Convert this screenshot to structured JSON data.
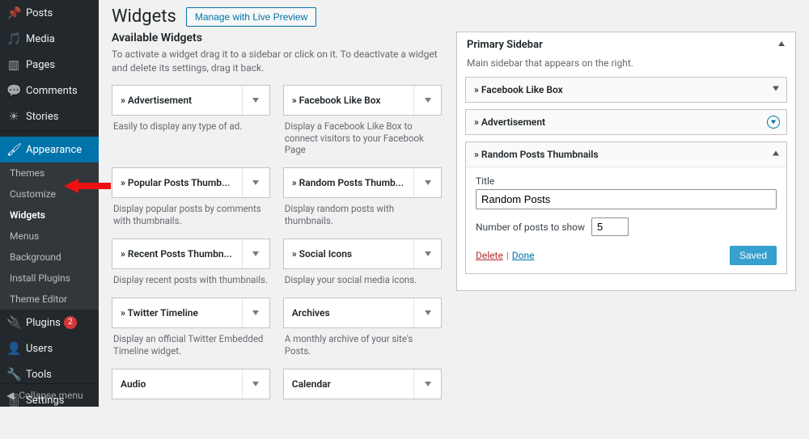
{
  "sidebar": {
    "items": [
      {
        "label": "Posts",
        "icon": "pin"
      },
      {
        "label": "Media",
        "icon": "media"
      },
      {
        "label": "Pages",
        "icon": "page"
      },
      {
        "label": "Comments",
        "icon": "comment"
      },
      {
        "label": "Stories",
        "icon": "story"
      }
    ],
    "appearance": {
      "label": "Appearance",
      "sub": [
        "Themes",
        "Customize",
        "Widgets",
        "Menus",
        "Background",
        "Install Plugins",
        "Theme Editor"
      ],
      "active_sub": "Widgets"
    },
    "items2": [
      {
        "label": "Plugins",
        "icon": "plug",
        "badge": "2"
      },
      {
        "label": "Users",
        "icon": "user"
      },
      {
        "label": "Tools",
        "icon": "wrench"
      },
      {
        "label": "Settings",
        "icon": "sliders"
      },
      {
        "label": "Groovy menu",
        "icon": "groovy"
      }
    ],
    "collapse": "Collapse menu"
  },
  "page": {
    "title": "Widgets",
    "preview_btn": "Manage with Live Preview",
    "available_heading": "Available Widgets",
    "available_desc": "To activate a widget drag it to a sidebar or click on it. To deactivate a widget and delete its settings, drag it back."
  },
  "available": [
    {
      "title": "» Advertisement",
      "desc": "Easily to display any type of ad."
    },
    {
      "title": "» Facebook Like Box",
      "desc": "Display a Facebook Like Box to connect visitors to your Facebook Page"
    },
    {
      "title": "» Popular Posts Thumb...",
      "desc": "Display popular posts by comments with thumbnails."
    },
    {
      "title": "» Random Posts Thumb...",
      "desc": "Display random posts with thumbnails."
    },
    {
      "title": "» Recent Posts Thumbn...",
      "desc": "Display recent posts with thumbnails."
    },
    {
      "title": "» Social Icons",
      "desc": "Display your social media icons."
    },
    {
      "title": "» Twitter Timeline",
      "desc": "Display an official Twitter Embedded Timeline widget."
    },
    {
      "title": "Archives",
      "desc": "A monthly archive of your site's Posts."
    },
    {
      "title": "Audio",
      "desc": ""
    },
    {
      "title": "Calendar",
      "desc": ""
    }
  ],
  "primary": {
    "title": "Primary Sidebar",
    "desc": "Main sidebar that appears on the right.",
    "widgets": [
      {
        "title": "» Facebook Like Box",
        "state": "collapsed"
      },
      {
        "title": "» Advertisement",
        "state": "collapsed-highlight"
      },
      {
        "title": "» Random Posts Thumbnails",
        "state": "open"
      }
    ],
    "form": {
      "title_label": "Title",
      "title_value": "Random Posts",
      "count_label": "Number of posts to show",
      "count_value": "5",
      "delete": "Delete",
      "done": "Done",
      "saved": "Saved"
    }
  }
}
